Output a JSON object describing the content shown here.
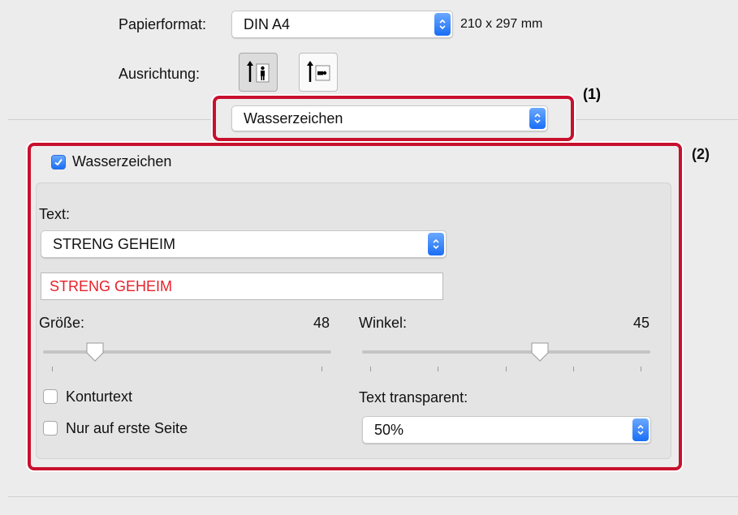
{
  "paper": {
    "label": "Papierformat:",
    "value": "DIN A4",
    "dimensions": "210 x 297 mm"
  },
  "orientation": {
    "label": "Ausrichtung:",
    "options": [
      "portrait",
      "landscape"
    ],
    "selected": "portrait"
  },
  "panel_select": {
    "value": "Wasserzeichen",
    "callout": "(1)"
  },
  "watermark": {
    "callout": "(2)",
    "enable_label": "Wasserzeichen",
    "enabled": true,
    "text_label": "Text:",
    "text_preset": "STRENG GEHEIM",
    "text_value": "STRENG GEHEIM",
    "text_color": "#e8202a",
    "size_label": "Größe:",
    "size_value": "48",
    "angle_label": "Winkel:",
    "angle_value": "45",
    "outline_label": "Konturtext",
    "outline_checked": false,
    "first_page_label": "Nur auf erste Seite",
    "first_page_checked": false,
    "transparent_label": "Text transparent:",
    "transparent_value": "50%"
  },
  "colors": {
    "callout": "#c8102e",
    "accent": "#1a6ef5"
  }
}
